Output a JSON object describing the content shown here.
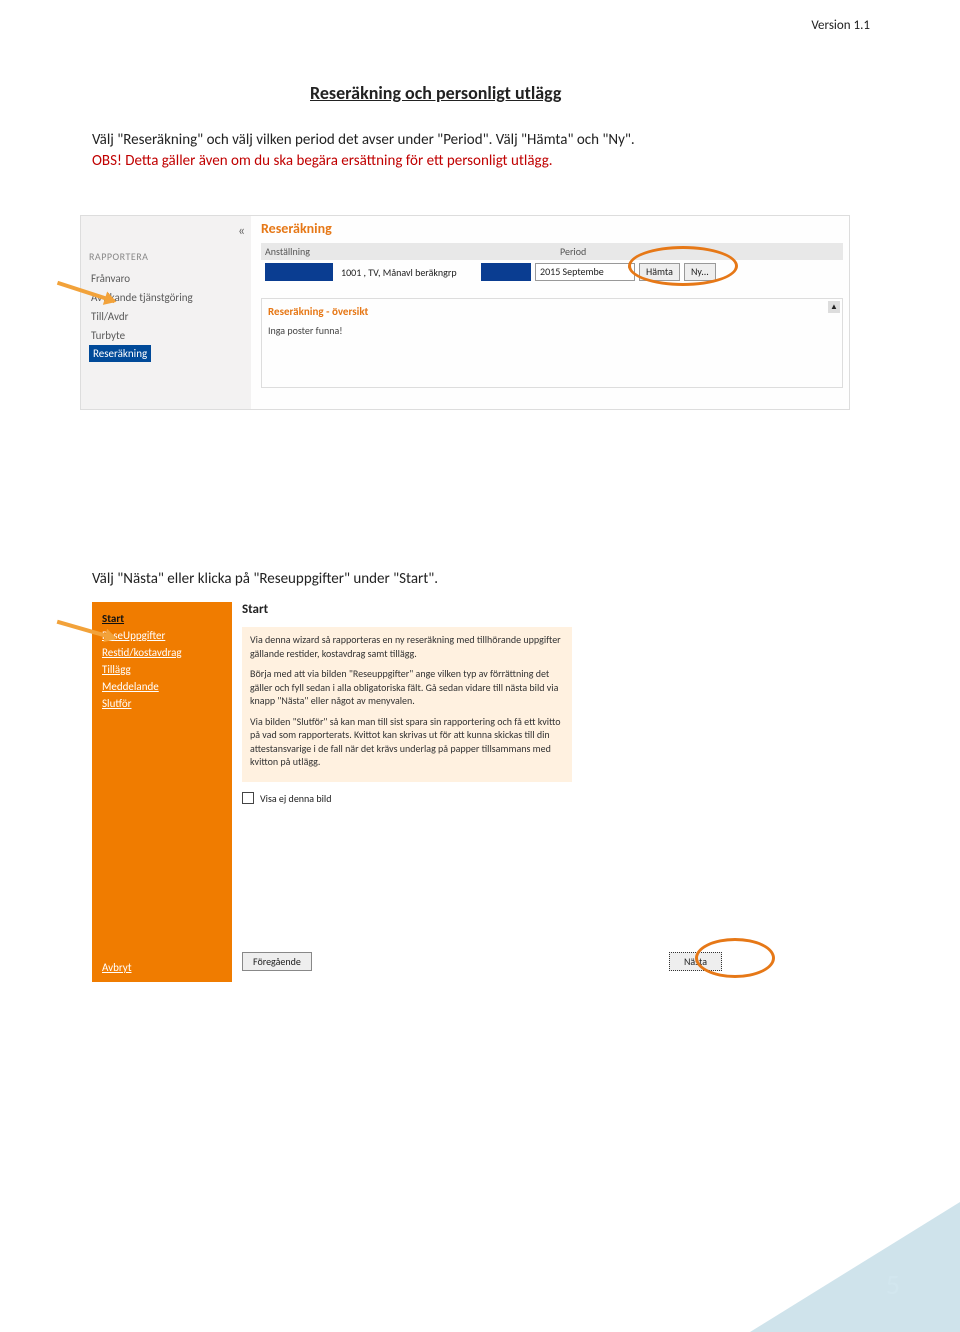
{
  "version": "Version 1.1",
  "page_number": "5",
  "title": "Reseräkning och personligt utlägg",
  "intro_line1": "Välj \"Reseräkning\" och välj vilken period det avser under \"Period\". Välj \"Hämta\" och \"Ny\".",
  "intro_line2": "OBS! Detta gäller även om du ska begära ersättning för ett personligt utlägg.",
  "mid_text": "Välj \"Nästa\" eller klicka på \"Reseuppgifter\" under \"Start\".",
  "shot1": {
    "collapse": "«",
    "side_heading": "RAPPORTERA",
    "side_items": [
      "Frånvaro",
      "Avvikande tjänstgöring",
      "Till/Avdr",
      "Turbyte",
      "Reseräkning"
    ],
    "main_title": "Reseräkning",
    "label_anst": "Anställning",
    "label_period": "Period",
    "employment_text": "1001 , TV, Månavl beräkngrp",
    "period_value": "2015 Septembe",
    "btn_hamta": "Hämta",
    "btn_ny": "Ny...",
    "overview_title": "Reseräkning - översikt",
    "overview_text": "Inga poster funna!",
    "scroll_up": "▲"
  },
  "shot2": {
    "nav": [
      "Start",
      "ReseUppgifter",
      "Restid/kostavdrag",
      "Tillägg",
      "Meddelande",
      "Slutför"
    ],
    "cancel": "Avbryt",
    "wiz_title": "Start",
    "p1": "Via denna wizard så rapporteras en ny reseräkning med tillhörande uppgifter gällande restider, kostavdrag samt tillägg.",
    "p2": "Börja med att via bilden \"Reseuppgifter\" ange vilken typ av förrättning det gäller och fyll sedan i alla obligatoriska fält. Gå sedan vidare till nästa bild via knapp \"Nästa\" eller något av menyvalen.",
    "p3": "Via bilden \"Slutför\" så kan man till sist spara sin rapportering och få ett kvitto på vad som rapporterats. Kvittot kan skrivas ut för att kunna skickas till din attestansvarige i de fall när det krävs underlag på papper tillsammans med kvitton på utlägg.",
    "chk_label": "Visa ej denna bild",
    "btn_prev": "Föregående",
    "btn_next": "Nästa"
  }
}
